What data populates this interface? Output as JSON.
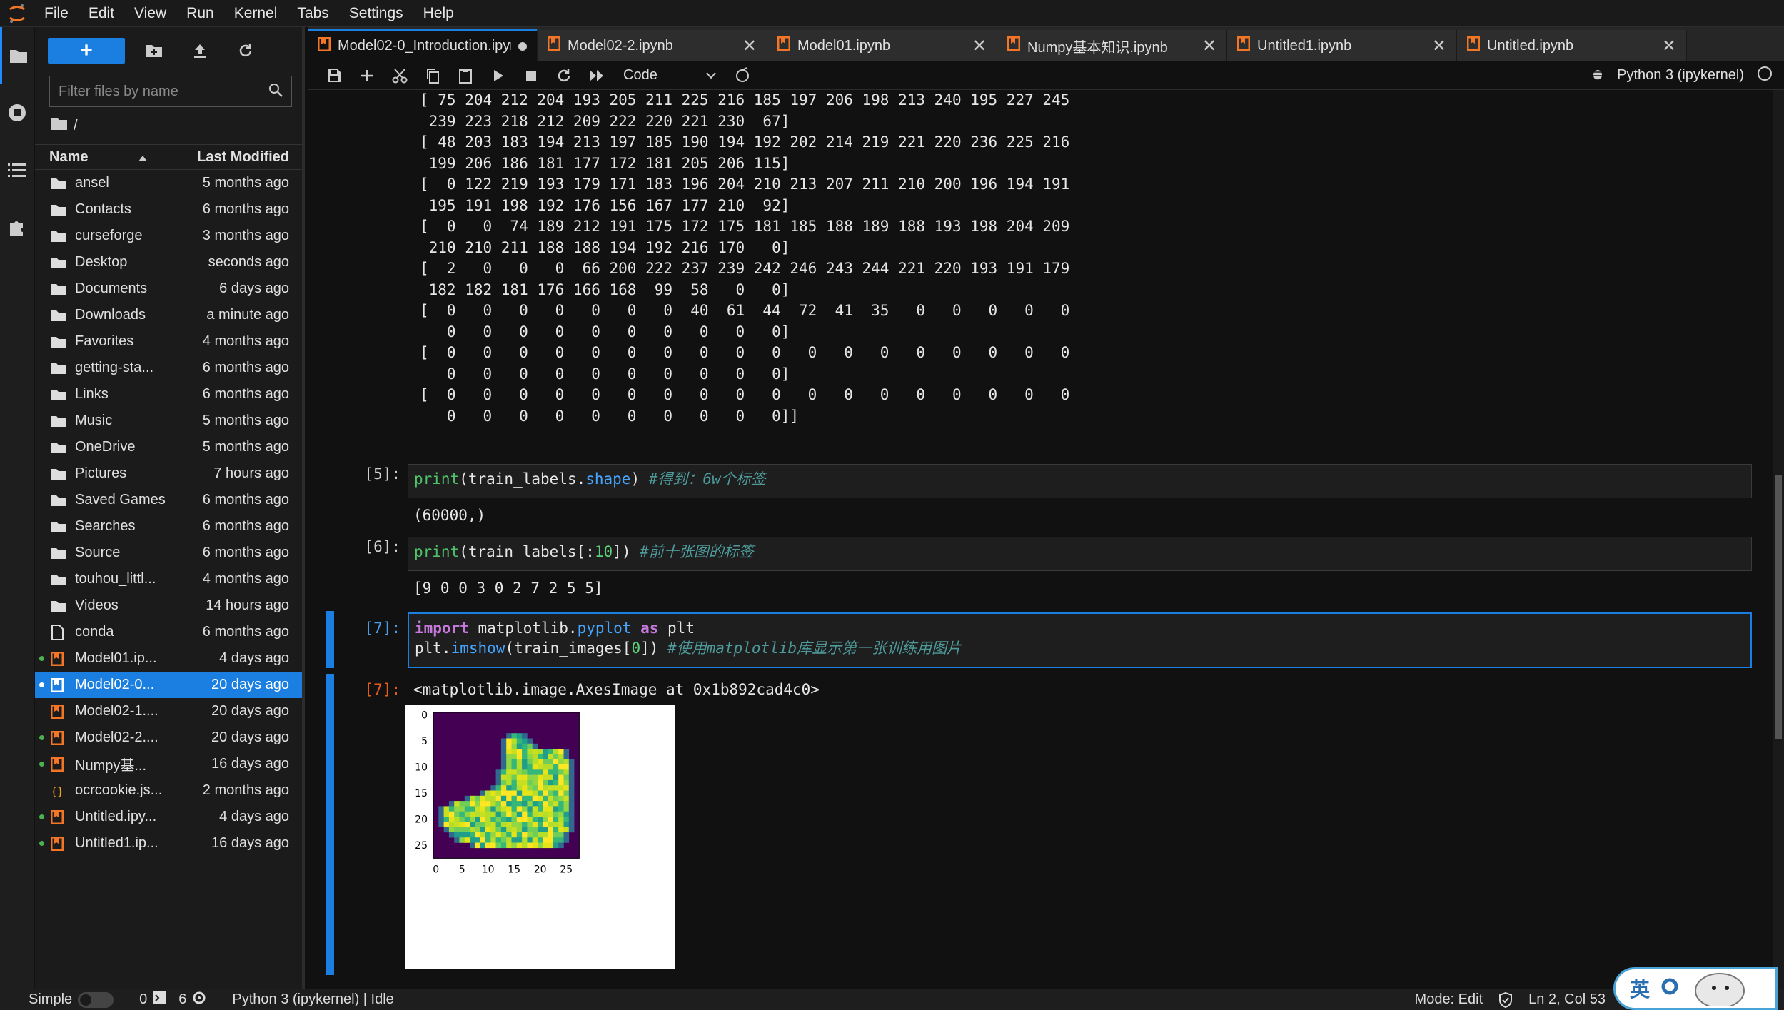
{
  "menubar": {
    "items": [
      "File",
      "Edit",
      "View",
      "Run",
      "Kernel",
      "Tabs",
      "Settings",
      "Help"
    ]
  },
  "filebrowser": {
    "filter_placeholder": "Filter files by name",
    "breadcrumb": "/",
    "col_name": "Name",
    "col_modified": "Last Modified",
    "rows": [
      {
        "name": "ansel",
        "modified": "5 months ago",
        "type": "folder"
      },
      {
        "name": "Contacts",
        "modified": "6 months ago",
        "type": "folder"
      },
      {
        "name": "curseforge",
        "modified": "3 months ago",
        "type": "folder"
      },
      {
        "name": "Desktop",
        "modified": "seconds ago",
        "type": "folder"
      },
      {
        "name": "Documents",
        "modified": "6 days ago",
        "type": "folder"
      },
      {
        "name": "Downloads",
        "modified": "a minute ago",
        "type": "folder"
      },
      {
        "name": "Favorites",
        "modified": "4 months ago",
        "type": "folder"
      },
      {
        "name": "getting-sta...",
        "modified": "6 months ago",
        "type": "folder"
      },
      {
        "name": "Links",
        "modified": "6 months ago",
        "type": "folder"
      },
      {
        "name": "Music",
        "modified": "5 months ago",
        "type": "folder"
      },
      {
        "name": "OneDrive",
        "modified": "5 months ago",
        "type": "folder"
      },
      {
        "name": "Pictures",
        "modified": "7 hours ago",
        "type": "folder"
      },
      {
        "name": "Saved Games",
        "modified": "6 months ago",
        "type": "folder"
      },
      {
        "name": "Searches",
        "modified": "6 months ago",
        "type": "folder"
      },
      {
        "name": "Source",
        "modified": "6 months ago",
        "type": "folder"
      },
      {
        "name": "touhou_littl...",
        "modified": "4 months ago",
        "type": "folder"
      },
      {
        "name": "Videos",
        "modified": "14 hours ago",
        "type": "folder"
      },
      {
        "name": "conda",
        "modified": "6 months ago",
        "type": "file"
      },
      {
        "name": "Model01.ip...",
        "modified": "4 days ago",
        "type": "notebook",
        "running": true
      },
      {
        "name": "Model02-0...",
        "modified": "20 days ago",
        "type": "notebook",
        "running": true,
        "selected": true
      },
      {
        "name": "Model02-1....",
        "modified": "20 days ago",
        "type": "notebook"
      },
      {
        "name": "Model02-2....",
        "modified": "20 days ago",
        "type": "notebook",
        "running": true
      },
      {
        "name": "Numpy基...",
        "modified": "16 days ago",
        "type": "notebook",
        "running": true
      },
      {
        "name": "ocrcookie.js...",
        "modified": "2 months ago",
        "type": "json"
      },
      {
        "name": "Untitled.ipy...",
        "modified": "4 days ago",
        "type": "notebook",
        "running": true
      },
      {
        "name": "Untitled1.ip...",
        "modified": "16 days ago",
        "type": "notebook",
        "running": true
      }
    ]
  },
  "tabs": [
    {
      "label": "Model02-0_Introduction.ipyr",
      "active": true,
      "dirty": true
    },
    {
      "label": "Model02-2.ipynb"
    },
    {
      "label": "Model01.ipynb"
    },
    {
      "label": "Numpy基本知识.ipynb"
    },
    {
      "label": "Untitled1.ipynb"
    },
    {
      "label": "Untitled.ipynb"
    }
  ],
  "toolbar": {
    "cell_type": "Code",
    "kernel": "Python 3 (ipykernel)"
  },
  "output_array_lines": [
    "[ 75 204 212 204 193 205 211 225 216 185 197 206 198 213 240 195 227 245",
    " 239 223 218 212 209 222 220 221 230  67]",
    "[ 48 203 183 194 213 197 185 190 194 192 202 214 219 221 220 236 225 216",
    " 199 206 186 181 177 172 181 205 206 115]",
    "[  0 122 219 193 179 171 183 196 204 210 213 207 211 210 200 196 194 191",
    " 195 191 198 192 176 156 167 177 210  92]",
    "[  0   0  74 189 212 191 175 172 175 181 185 188 189 188 193 198 204 209",
    " 210 210 211 188 188 194 192 216 170   0]",
    "[  2   0   0   0  66 200 222 237 239 242 246 243 244 221 220 193 191 179",
    " 182 182 181 176 166 168  99  58   0   0]",
    "[  0   0   0   0   0   0   0  40  61  44  72  41  35   0   0   0   0   0",
    "   0   0   0   0   0   0   0   0   0   0]",
    "[  0   0   0   0   0   0   0   0   0   0   0   0   0   0   0   0   0   0",
    "   0   0   0   0   0   0   0   0   0   0]",
    "[  0   0   0   0   0   0   0   0   0   0   0   0   0   0   0   0   0   0",
    "   0   0   0   0   0   0   0   0   0   0]]"
  ],
  "cells": {
    "c5": {
      "prompt": "[5]:",
      "output": "(60000,)"
    },
    "c6": {
      "prompt": "[6]:",
      "output": "[9 0 0 3 0 2 7 2 5 5]"
    },
    "c7": {
      "prompt": "[7]:",
      "out_prompt": "[7]:",
      "output": "<matplotlib.image.AxesImage at 0x1b892cad4c0>"
    }
  },
  "plot": {
    "yticks": [
      "0",
      "5",
      "10",
      "15",
      "20",
      "25"
    ],
    "xticks": [
      "0",
      "5",
      "10",
      "15",
      "20",
      "25"
    ]
  },
  "statusbar": {
    "mode_label": "Simple",
    "terminals": "0",
    "kernels": "6",
    "kernel_status": "Python 3 (ipykernel) | Idle",
    "edit_mode": "Mode: Edit",
    "cursor": "Ln 2, Col 53"
  },
  "ime": {
    "label": "英"
  }
}
